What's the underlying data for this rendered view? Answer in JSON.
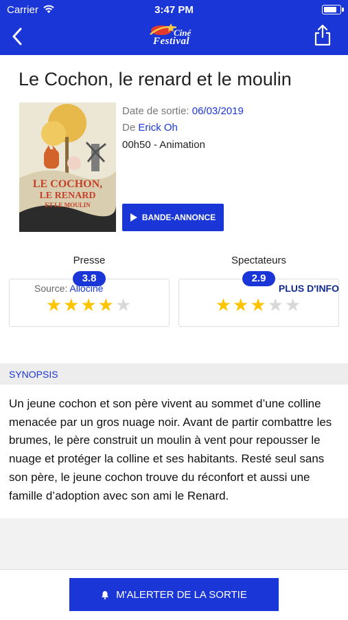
{
  "status": {
    "carrier": "Carrier",
    "time": "3:47 PM",
    "battery_level": 0.9
  },
  "header": {
    "logo_top": "Ciné",
    "logo_bottom": "Festival"
  },
  "movie": {
    "title": "Le Cochon, le renard et le moulin",
    "poster": {
      "line1": "LE COCHON,",
      "line2": "LE RENARD",
      "line3": "ET LE MOULIN"
    },
    "release_label": "Date de sortie:",
    "release_date": "06/03/2019",
    "director_label": "De",
    "director": "Erick Oh",
    "duration_genre": "00h50 - Animation",
    "trailer_label": "BANDE-ANNONCE"
  },
  "ratings": {
    "press": {
      "label": "Presse",
      "score": "3.8",
      "stars": 4
    },
    "audience": {
      "label": "Spectateurs",
      "score": "2.9",
      "stars": 3
    },
    "max_stars": 5,
    "source_label": "Source:",
    "source": "Allociné",
    "more_label": "PLUS D'INFO"
  },
  "synopsis": {
    "heading": "SYNOPSIS",
    "text": "Un jeune cochon et son père vivent au sommet d’une colline menacée par un gros nuage noir. Avant de partir combattre les brumes, le père construit un moulin à vent pour repousser le nuage et protéger la colline et ses habitants. Resté seul sans son père, le jeune cochon trouve du réconfort et aussi une famille d’adoption avec son ami le Renard."
  },
  "footer": {
    "alert_label": "M'ALERTER DE LA SORTIE"
  },
  "colors": {
    "primary": "#1a36d6",
    "star": "#ffc400",
    "star_empty": "#d8d8d8"
  }
}
